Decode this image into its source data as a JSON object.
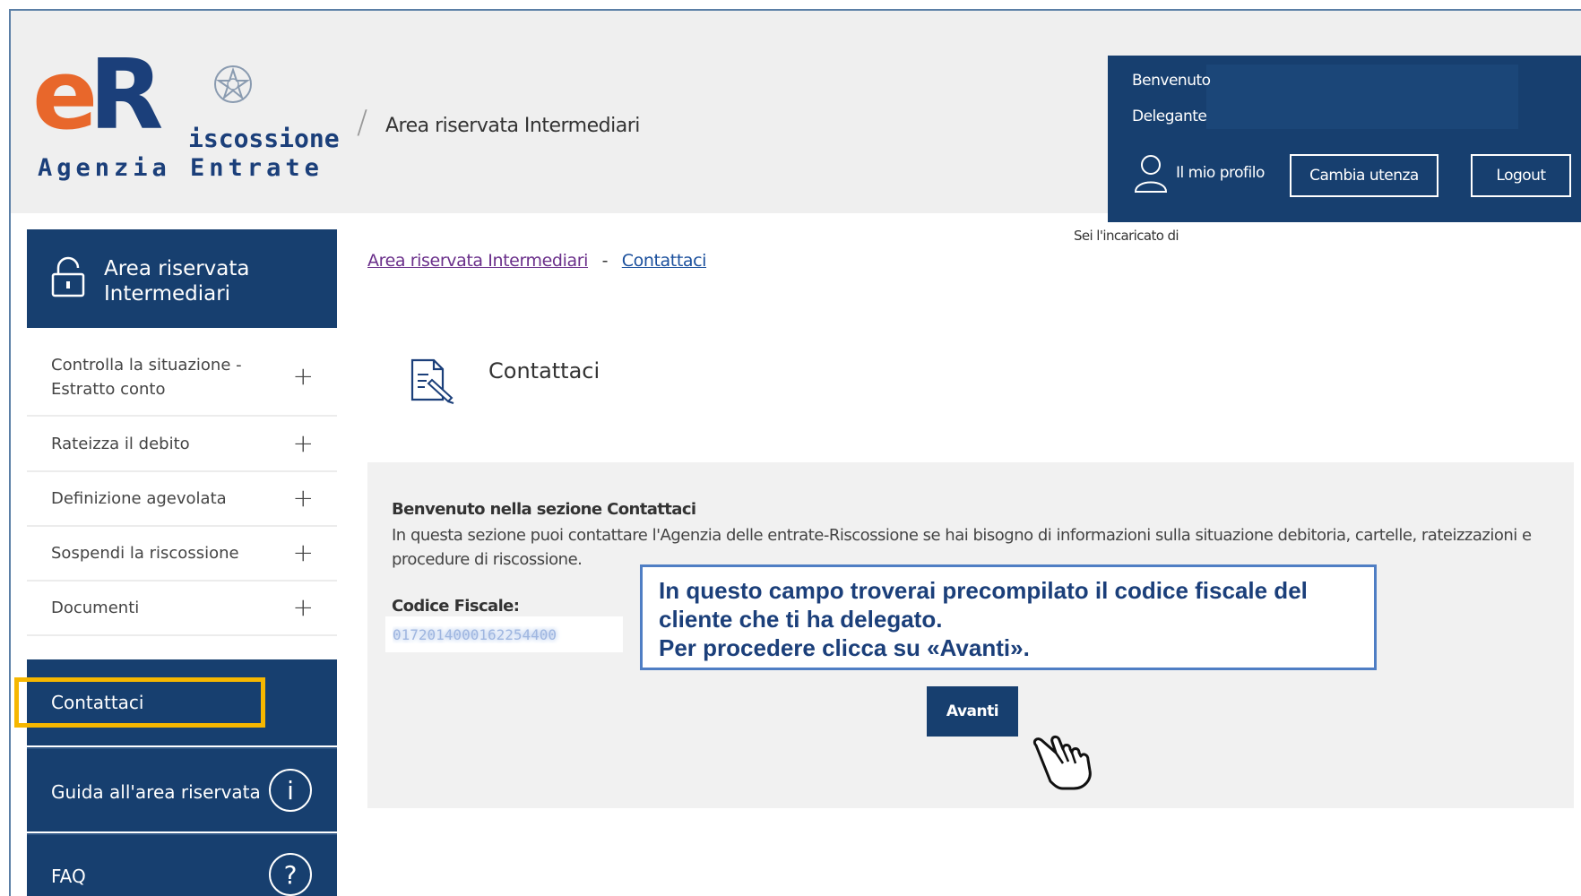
{
  "header": {
    "logo_main": "eR",
    "logo_sub": "iscossione",
    "logo_agency": "Agenzia Entrate",
    "site_title": "Area riservata Intermediari"
  },
  "userbox": {
    "welcome": "Benvenuto",
    "delegante": "Delegante",
    "profile_label": "Il mio profilo",
    "cambia_label": "Cambia utenza",
    "logout_label": "Logout"
  },
  "incaricato": "Sei l'incaricato di",
  "sidebar": {
    "title_line1": "Area riservata",
    "title_line2": "Intermediari",
    "items": [
      {
        "line1": "Controlla la situazione -",
        "line2": "Estratto conto"
      },
      {
        "line1": "Rateizza il debito"
      },
      {
        "line1": "Definizione agevolata"
      },
      {
        "line1": "Sospendi la riscossione"
      },
      {
        "line1": "Documenti"
      }
    ],
    "contattaci": "Contattaci",
    "guida": "Guida all'area riservata",
    "faq": "FAQ",
    "info_glyph": "i",
    "faq_glyph": "?"
  },
  "breadcrumb": {
    "home": "Area riservata Intermediari",
    "sep": "-",
    "current": "Contattaci"
  },
  "main": {
    "title": "Contattaci",
    "panel_heading": "Benvenuto nella sezione Contattaci",
    "panel_text": "In questa sezione puoi contattare l'Agenzia delle entrate-Riscossione se hai bisogno di informazioni sulla situazione debitoria, cartelle, rateizzazioni e procedure di riscossione.",
    "cf_label": "Codice Fiscale:",
    "cf_value": "0172014000162254400",
    "callout_line1": "In questo campo troverai precompilato il codice fiscale del",
    "callout_line2": "cliente che ti ha delegato.",
    "callout_line3": "Per procedere clicca su «Avanti».",
    "avanti_label": "Avanti"
  },
  "colors": {
    "navy": "#173f6f",
    "orange": "#e8672b",
    "highlight": "#f6b700",
    "callout_border": "#4f7ec4"
  }
}
